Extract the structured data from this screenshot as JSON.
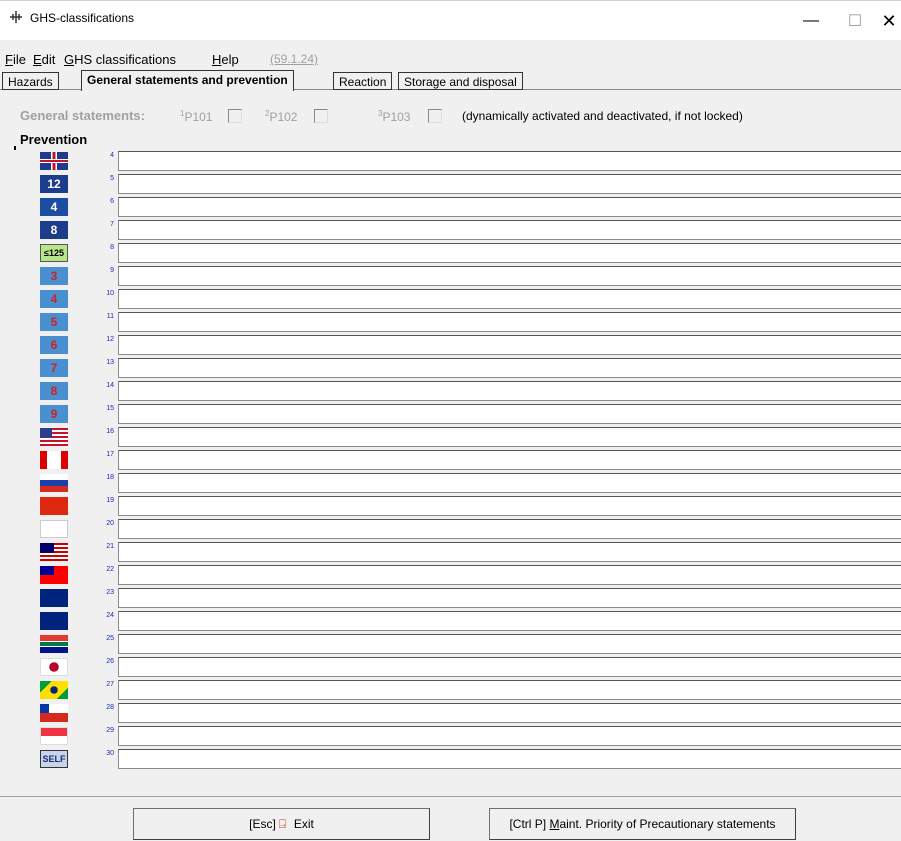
{
  "window": {
    "title": "GHS-classifications",
    "minimize": "—",
    "maximize": "☐",
    "close": "✕"
  },
  "menu": {
    "items": [
      {
        "ul": "F",
        "rest": "ile"
      },
      {
        "ul": "E",
        "rest": "dit"
      },
      {
        "ul": "G",
        "rest": "HS classifications"
      },
      {
        "ul": "H",
        "rest": "elp"
      }
    ],
    "version": "(59.1.24)"
  },
  "tabs": [
    "Hazards",
    "General statements and prevention",
    "Reaction",
    "Storage and disposal"
  ],
  "active_tab": 1,
  "general": {
    "label": "General statements:",
    "checks": [
      {
        "sup": "1",
        "label": "P101"
      },
      {
        "sup": "2",
        "label": "P102"
      },
      {
        "sup": "3",
        "label": "P103"
      }
    ],
    "note": "(dynamically activated and deactivated, if not locked)"
  },
  "prevention_label": "Prevention",
  "rows": [
    {
      "num": "4",
      "flag": "uk-flag-icon",
      "text": ""
    },
    {
      "num": "5",
      "flag": "badge-12-icon",
      "text": "12"
    },
    {
      "num": "6",
      "flag": "badge-4-icon",
      "text": "4"
    },
    {
      "num": "7",
      "flag": "badge-8-icon",
      "text": "8"
    },
    {
      "num": "8",
      "flag": "badge-125-icon",
      "text": "≤125"
    },
    {
      "num": "9",
      "flag": "badge-3-icon",
      "text": "3"
    },
    {
      "num": "10",
      "flag": "badge-4-red-icon",
      "text": "4"
    },
    {
      "num": "11",
      "flag": "badge-5-icon",
      "text": "5"
    },
    {
      "num": "12",
      "flag": "badge-6-icon",
      "text": "6"
    },
    {
      "num": "13",
      "flag": "badge-7-icon",
      "text": "7"
    },
    {
      "num": "14",
      "flag": "badge-8-red-icon",
      "text": "8"
    },
    {
      "num": "15",
      "flag": "badge-9-icon",
      "text": "9"
    },
    {
      "num": "16",
      "flag": "us-flag-icon",
      "text": ""
    },
    {
      "num": "17",
      "flag": "canada-flag-icon",
      "text": ""
    },
    {
      "num": "18",
      "flag": "russia-flag-icon",
      "text": ""
    },
    {
      "num": "19",
      "flag": "china-flag-icon",
      "text": ""
    },
    {
      "num": "20",
      "flag": "korea-flag-icon",
      "text": ""
    },
    {
      "num": "21",
      "flag": "malaysia-flag-icon",
      "text": ""
    },
    {
      "num": "22",
      "flag": "taiwan-flag-icon",
      "text": ""
    },
    {
      "num": "23",
      "flag": "australia-flag-icon",
      "text": ""
    },
    {
      "num": "24",
      "flag": "newzealand-flag-icon",
      "text": ""
    },
    {
      "num": "25",
      "flag": "southafrica-flag-icon",
      "text": ""
    },
    {
      "num": "26",
      "flag": "japan-flag-icon",
      "text": ""
    },
    {
      "num": "27",
      "flag": "brazil-flag-icon",
      "text": ""
    },
    {
      "num": "28",
      "flag": "chile-flag-icon",
      "text": ""
    },
    {
      "num": "29",
      "flag": "singapore-flag-icon",
      "text": ""
    },
    {
      "num": "30",
      "flag": "self-badge-icon",
      "text": "SELF"
    }
  ],
  "buttons": {
    "exit": {
      "key": "[Esc]",
      "label": "Exit",
      "icon": "exit-door-icon"
    },
    "priority": {
      "key": "[Ctrl P]",
      "ul": "M",
      "label": "aint. Priority of Precautionary statements"
    }
  }
}
